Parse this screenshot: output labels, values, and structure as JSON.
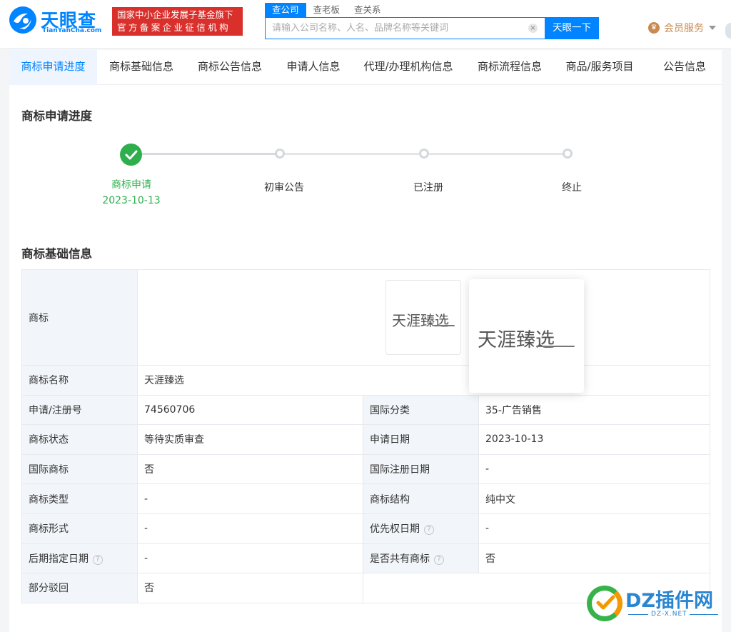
{
  "header": {
    "logo_cn": "天眼查",
    "logo_en": "TianYanCha.com",
    "gov_badge_line1": "国家中小企业发展子基金旗下",
    "gov_badge_line2": "官方备案企业征信机构",
    "search_tabs": [
      "查公司",
      "查老板",
      "查关系"
    ],
    "search_placeholder": "请输入公司名称、人名、品牌名称等关键词",
    "search_button": "天眼一下",
    "clear_icon": "×",
    "vip_icon": "♛",
    "vip_label": "会员服务"
  },
  "tabs": [
    "商标申请进度",
    "商标基础信息",
    "商标公告信息",
    "申请人信息",
    "代理/办理机构信息",
    "商标流程信息",
    "商品/服务项目",
    "公告信息"
  ],
  "progress": {
    "title": "商标申请进度",
    "steps": [
      {
        "label": "商标申请",
        "date": "2023-10-13",
        "status": "done"
      },
      {
        "label": "初审公告",
        "status": "pending"
      },
      {
        "label": "已注册",
        "status": "pending"
      },
      {
        "label": "终止",
        "status": "pending"
      }
    ]
  },
  "basic": {
    "title": "商标基础信息",
    "logo_label": "商标",
    "logo_text": "天涯臻选",
    "rows": [
      {
        "l1": "商标名称",
        "v1": "天涯臻选"
      },
      {
        "l1": "申请/注册号",
        "v1": "74560706",
        "l2": "国际分类",
        "v2": "35-广告销售"
      },
      {
        "l1": "商标状态",
        "v1": "等待实质审查",
        "l2": "申请日期",
        "v2": "2023-10-13"
      },
      {
        "l1": "国际商标",
        "v1": "否",
        "l2": "国际注册日期",
        "v2": "-"
      },
      {
        "l1": "商标类型",
        "v1": "-",
        "l2": "商标结构",
        "v2": "纯中文"
      },
      {
        "l1": "商标形式",
        "v1": "-",
        "l2": "优先权日期",
        "v2": "-"
      },
      {
        "l1": "后期指定日期",
        "v1": "-",
        "l2": "是否共有商标",
        "v2": "否"
      },
      {
        "l1": "部分驳回",
        "v1": "否"
      }
    ],
    "help_glyph": "?"
  },
  "watermark": {
    "text": "DZ插件网",
    "url": "DZ-X.NET"
  },
  "colors": {
    "brand": "#0084ff",
    "gov_red": "#d9302c",
    "success": "#2fae4d",
    "vip": "#c9894f"
  }
}
